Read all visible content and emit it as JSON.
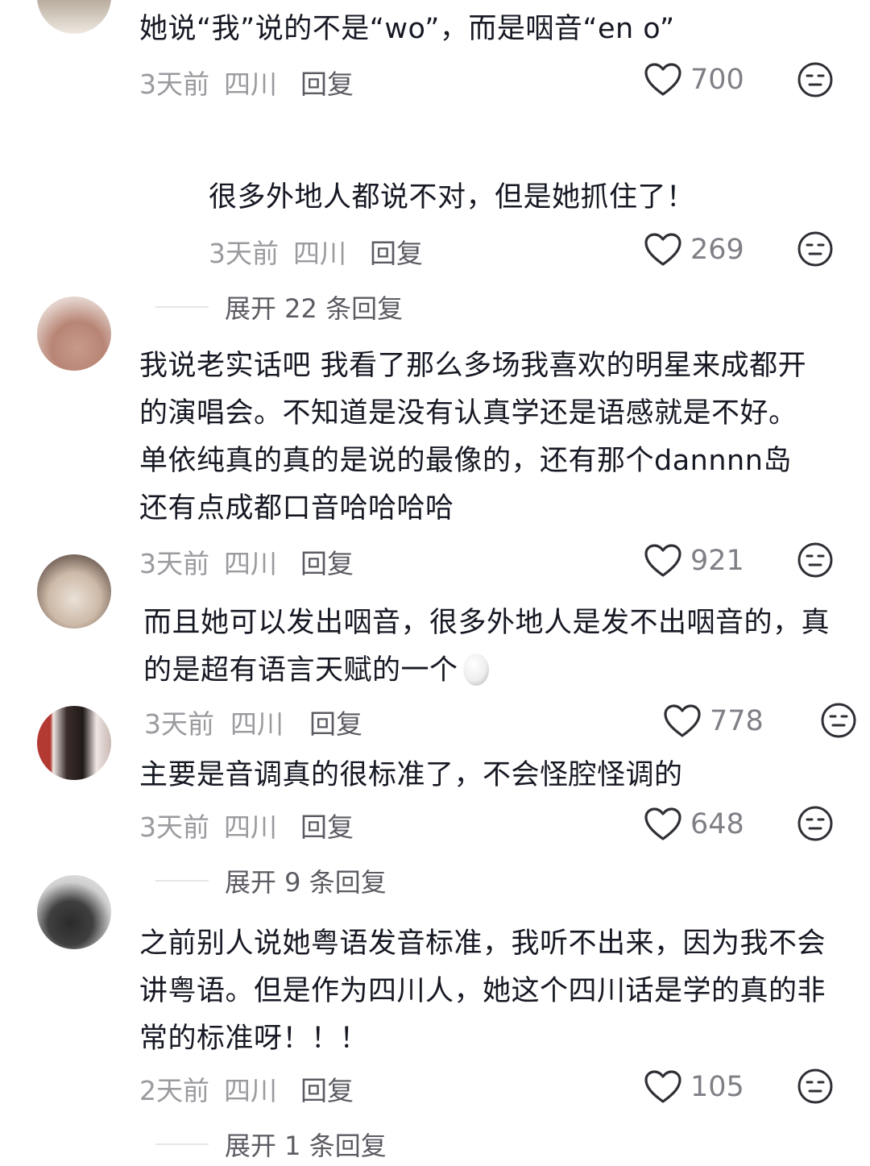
{
  "comments": [
    {
      "text": "她说“我”说的不是“wo”，而是咽音“en o”",
      "date": "3天前",
      "location": "四川",
      "reply_label": "回复",
      "likes": "700"
    },
    {
      "text": "很多外地人都说不对，但是她抓住了！",
      "date": "3天前",
      "location": "四川",
      "reply_label": "回复",
      "likes": "269"
    },
    {
      "text": "我说老实话吧 我看了那么多场我喜欢的明星来成都开的演唱会。不知道是没有认真学还是语感就是不好。单依纯真的真的是说的最像的，还有那个dannnn岛还有点成都口音哈哈哈哈",
      "date": "3天前",
      "location": "四川",
      "reply_label": "回复",
      "likes": "921"
    },
    {
      "text": "而且她可以发出咽音，很多外地人是发不出咽音的，真的是超有语言天赋的一个",
      "date": "3天前",
      "location": "四川",
      "reply_label": "回复",
      "likes": "778"
    },
    {
      "text": "主要是音调真的很标准了，不会怪腔怪调的",
      "date": "3天前",
      "location": "四川",
      "reply_label": "回复",
      "likes": "648"
    },
    {
      "text": "之前别人说她粤语发音标准，我听不出来，因为我不会讲粤语。但是作为四川人，她这个四川话是学的真的非常的标准呀！！！",
      "date": "2天前",
      "location": "四川",
      "reply_label": "回复",
      "likes": "105"
    }
  ],
  "expand_replies": [
    "展开 22 条回复",
    "展开 9 条回复",
    "展开 1 条回复"
  ],
  "icons": {
    "like": "heart-outline-icon",
    "dislike": "neutral-face-icon",
    "emoji": "egg-emoji-icon"
  },
  "colors": {
    "text": "#161823",
    "meta": "#9a9a9f",
    "reply": "#5b5b63",
    "icon": "#2f2f35"
  }
}
